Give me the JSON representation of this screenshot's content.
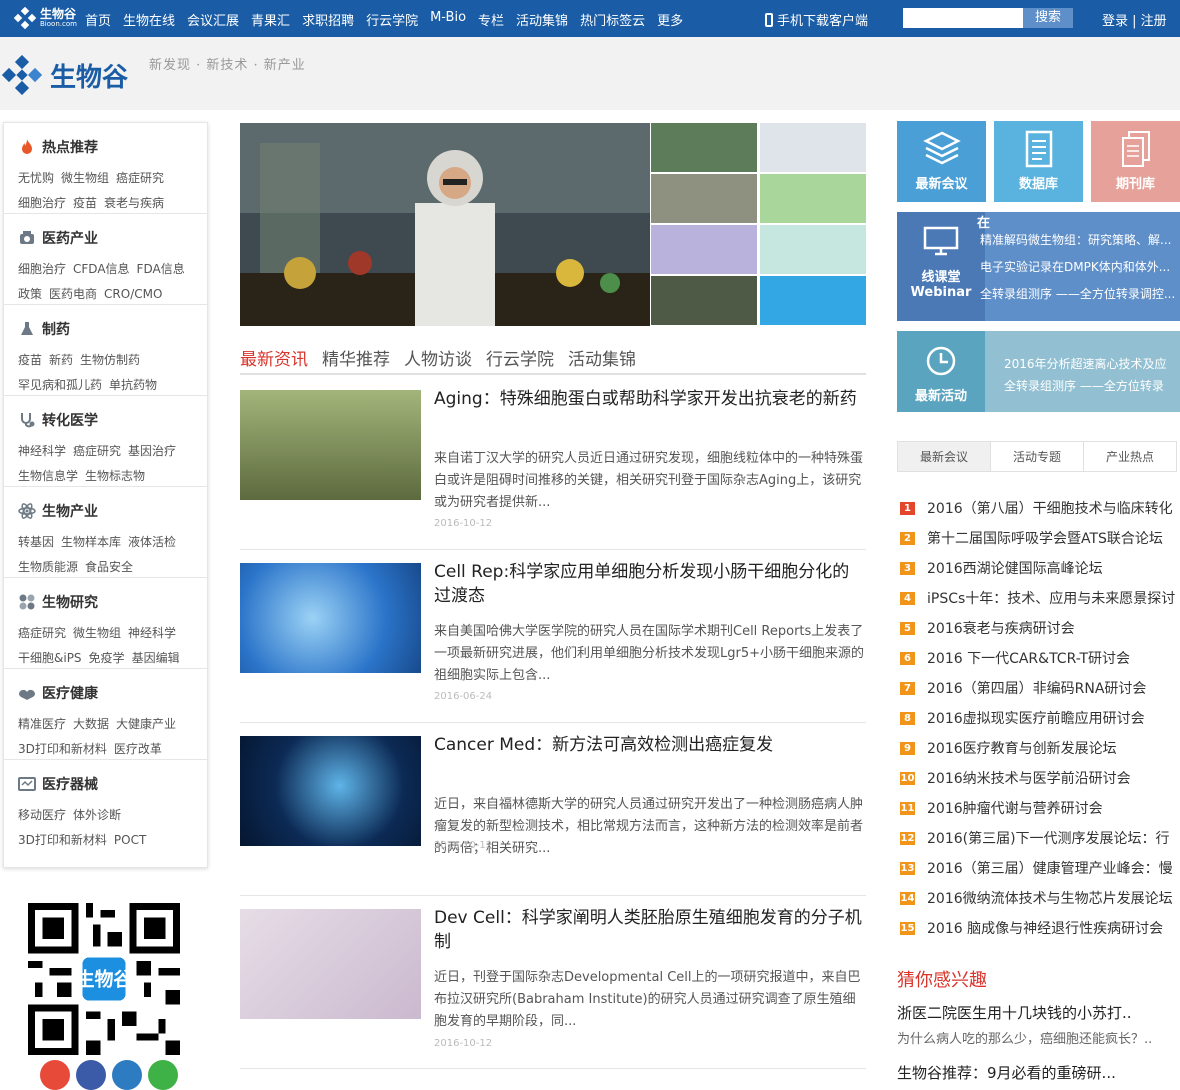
{
  "topbar": {
    "logo_text": "生物谷",
    "logo_sub": "Bioon.com",
    "nav": [
      "首页",
      "生物在线",
      "会议汇展",
      "青果汇",
      "求职招聘",
      "行云学院",
      "M-Bio",
      "专栏",
      "活动集锦",
      "热门标签云",
      "更多"
    ],
    "download": "手机下载客户端",
    "search_placeholder": "",
    "search_button": "搜索",
    "login": "登录 | 注册"
  },
  "header": {
    "brand": "生物谷",
    "slogan": "新发现 · 新技术 · 新产业"
  },
  "sidebar": [
    {
      "title": "热点推荐",
      "icon": "fire-icon",
      "rows": [
        [
          "无忧购",
          "微生物组",
          "癌症研究"
        ],
        [
          "细胞治疗",
          "疫苗",
          "衰老与疾病"
        ]
      ]
    },
    {
      "title": "医药产业",
      "icon": "pill-box-icon",
      "rows": [
        [
          "细胞治疗",
          "CFDA信息",
          "FDA信息"
        ],
        [
          "政策",
          "医药电商",
          "CRO/CMO"
        ]
      ]
    },
    {
      "title": "制药",
      "icon": "flask-icon",
      "rows": [
        [
          "疫苗",
          "新药",
          "生物仿制药"
        ],
        [
          "罕见病和孤儿药",
          "单抗药物"
        ]
      ]
    },
    {
      "title": "转化医学",
      "icon": "stethoscope-icon",
      "rows": [
        [
          "神经科学",
          "癌症研究",
          "基因治疗"
        ],
        [
          "生物信息学",
          "生物标志物"
        ]
      ]
    },
    {
      "title": "生物产业",
      "icon": "atom-icon",
      "rows": [
        [
          "转基因",
          "生物样本库",
          "液体活检"
        ],
        [
          "生物质能源",
          "食品安全"
        ]
      ]
    },
    {
      "title": "生物研究",
      "icon": "dna-icon",
      "rows": [
        [
          "癌症研究",
          "微生物组",
          "神经科学"
        ],
        [
          "干细胞&iPS",
          "免疫学",
          "基因编辑"
        ]
      ]
    },
    {
      "title": "医疗健康",
      "icon": "health-icon",
      "rows": [
        [
          "精准医疗",
          "大数据",
          "大健康产业"
        ],
        [
          "3D打印和新材料",
          "医疗改革"
        ]
      ]
    },
    {
      "title": "医疗器械",
      "icon": "device-icon",
      "rows": [
        [
          "移动医疗",
          "体外诊断"
        ],
        [
          "3D打印和新材料",
          "POCT"
        ]
      ]
    }
  ],
  "tabs": [
    "最新资讯",
    "精华推荐",
    "人物访谈",
    "行云学院",
    "活动集锦"
  ],
  "articles": [
    {
      "title": "Aging：特殊细胞蛋白或帮助科学家开发出抗衰老的新药",
      "desc": "来自诺丁汉大学的研究人员近日通过研究发现，细胞线粒体中的一种特殊蛋白或许是阻碍时间推移的关键，相关研究刊登于国际杂志Aging上，该研究或为研究者提供新...",
      "date": "2016-10-12",
      "img": "#6a7d4a"
    },
    {
      "title": "Cell Rep:科学家应用单细胞分析发现小肠干细胞分化的过渡态",
      "desc": "来自美国哈佛大学医学院的研究人员在国际学术期刊Cell Reports上发表了一项最新研究进展，他们利用单细胞分析技术发现Lgr5+小肠干细胞来源的祖细胞实际上包含...",
      "date": "2016-06-24",
      "img": "#2b74c9"
    },
    {
      "title": "Cancer Med：新方法可高效检测出癌症复发",
      "desc": "近日，来自福林德斯大学的研究人员通过研究开发出了一种检测肠癌病人肿瘤复发的新型检测技术，相比常规方法而言，这种新方法的检测效率是前者的两倍；相关研究...",
      "date": "2016-10-12",
      "img": "#0c2a55"
    },
    {
      "title": "Dev Cell：科学家阐明人类胚胎原生殖细胞发育的分子机制",
      "desc": "近日，刊登于国际杂志Developmental Cell上的一项研究报道中，来自巴布拉汉研究所(Babraham Institute)的研究人员通过研究调查了原生殖细胞发育的早期阶段，同...",
      "date": "2016-10-12",
      "img": "#d8cbd8"
    }
  ],
  "tiles": {
    "meeting": "最新会议",
    "database": "数据库",
    "journal": "期刊库",
    "webinar_label1": "线课堂",
    "webinar_label2": "Webinar",
    "webinar_top": "在",
    "webinar_items": [
      "精准解码微生物组：研究策略、解...",
      "电子实验记录在DMPK体内和体外...",
      "全转录组测序 ——全方位转录调控..."
    ],
    "events_label": "最新活动",
    "events_items": [
      "2016年分析超速离心技术及应",
      "全转录组测序 ——全方位转录"
    ],
    "colors": {
      "meeting": "#4a9fd6",
      "database": "#5ab2de",
      "journal": "#e6a29a",
      "webinar": "#5e8fc9",
      "events": "#92c0d2"
    }
  },
  "right_tabs": [
    "最新会议",
    "活动专题",
    "产业热点"
  ],
  "meetings": [
    "2016（第八届）干细胞技术与临床转化",
    "第十二届国际呼吸学会暨ATS联合论坛",
    "2016西湖论健国际高峰论坛",
    "iPSCs十年：技术、应用与未来愿景探讨",
    "2016衰老与疾病研讨会",
    "2016 下一代CAR&TCR-T研讨会",
    "2016（第四届）非编码RNA研讨会",
    "2016虚拟现实医疗前瞻应用研讨会",
    "2016医疗教育与创新发展论坛",
    "2016纳米技术与医学前沿研讨会",
    "2016肿瘤代谢与营养研讨会",
    "2016(第三届)下一代测序发展论坛：行",
    "2016（第三届）健康管理产业峰会：慢",
    "2016微纳流体技术与生物芯片发展论坛",
    "2016 脑成像与神经退行性疾病研讨会"
  ],
  "guess": {
    "title": "猜你感兴趣",
    "item1": "浙医二院医生用十几块钱的小苏打..",
    "item1_sub": "为什么病人吃的那么少，癌细胞还能疯长？..",
    "item2": "生物谷推荐：9月必看的重磅研..."
  }
}
